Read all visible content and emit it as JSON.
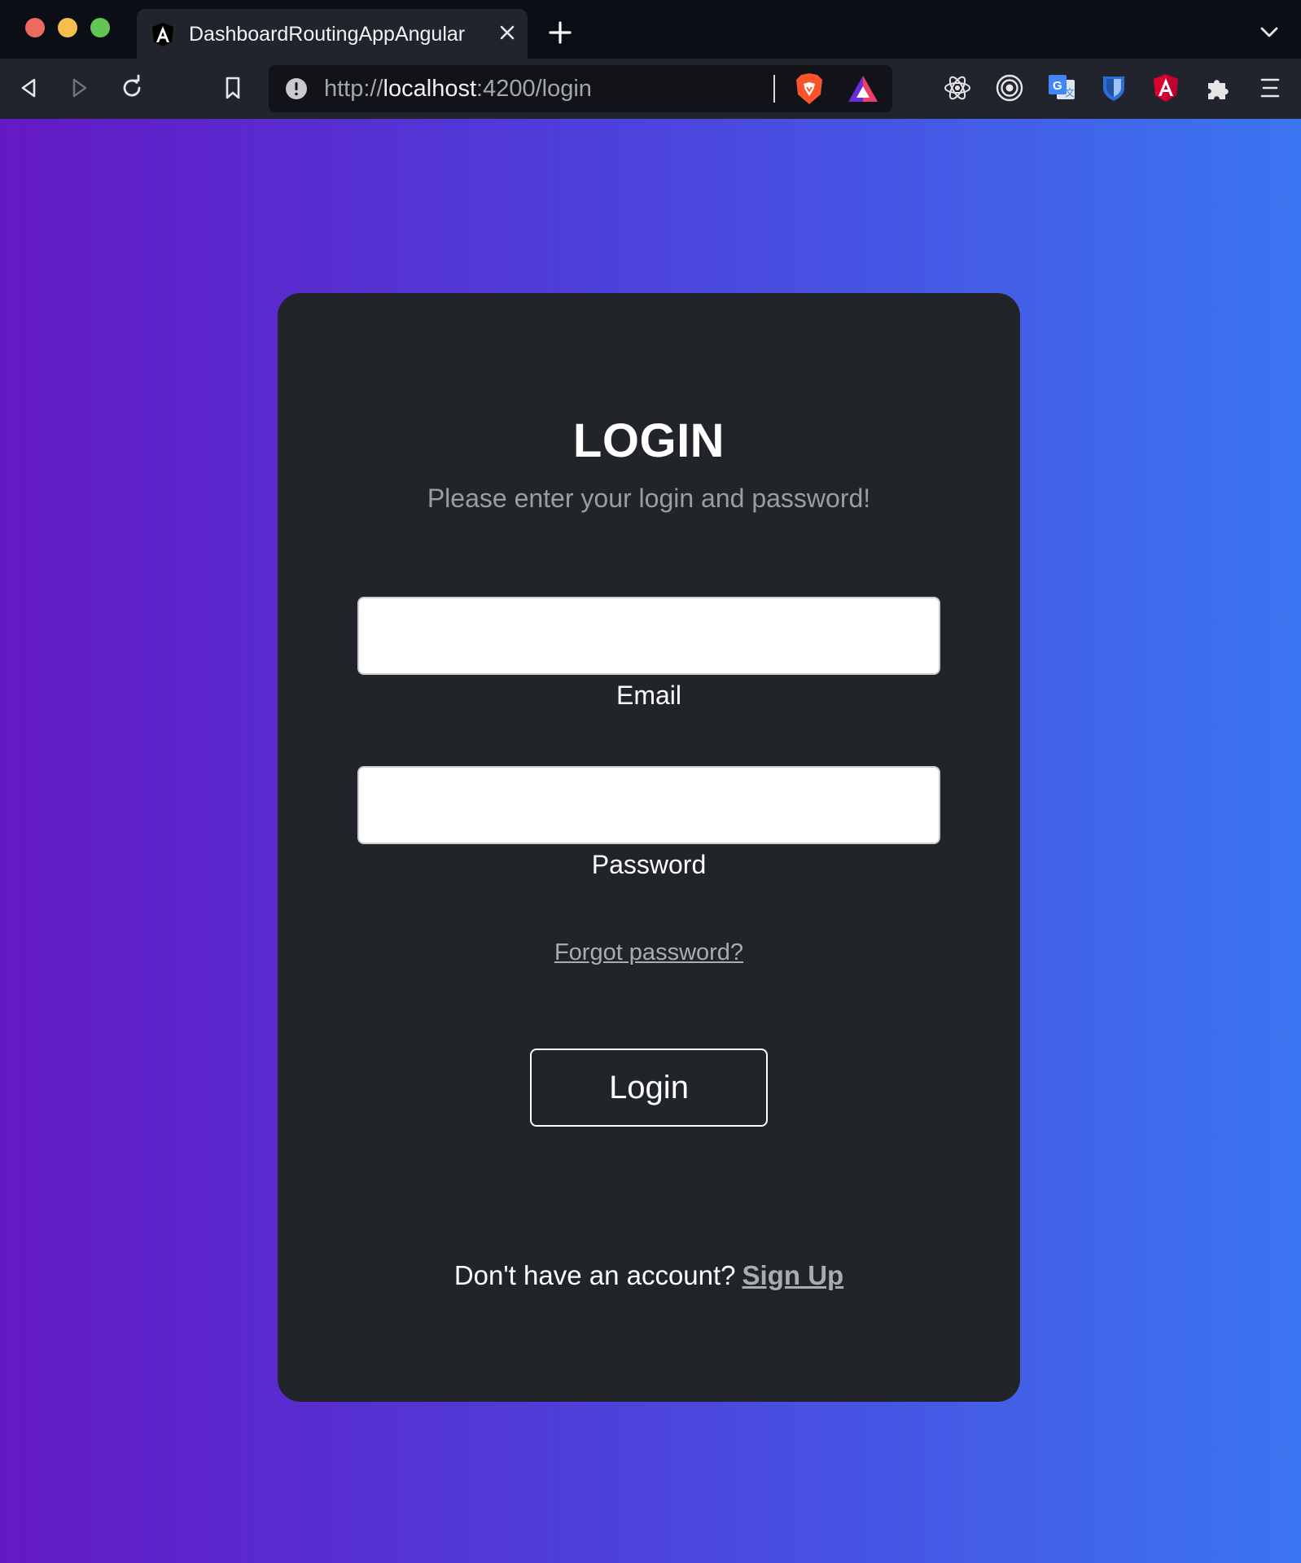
{
  "browser": {
    "tab": {
      "title": "DashboardRoutingAppAngular",
      "icon": "angular-icon"
    },
    "url": {
      "scheme": "http://",
      "host": "localhost",
      "rest": ":4200/login"
    },
    "toolbar_icons": [
      "back-icon",
      "forward-icon",
      "reload-icon",
      "bookmark-icon",
      "info-icon",
      "brave-shields-icon",
      "brave-rewards-icon"
    ],
    "extension_icons": [
      "react-devtools-icon",
      "target-extension-icon",
      "google-translate-icon",
      "bitwarden-shield-icon",
      "angular-devtools-icon",
      "puzzle-icon",
      "menu-icon"
    ],
    "colors": {
      "tabbar": "#0c0e16",
      "toolbar": "#21242d"
    }
  },
  "login": {
    "title": "LOGIN",
    "subtitle": "Please enter your login and password!",
    "email": {
      "label": "Email",
      "value": "",
      "placeholder": ""
    },
    "password": {
      "label": "Password",
      "value": "",
      "placeholder": ""
    },
    "forgot_password": "Forgot password?",
    "login_button": "Login",
    "signup_prompt": "Don't have an account?",
    "signup_link": "Sign Up"
  },
  "colors": {
    "gradient_start": "#6419c4",
    "gradient_end": "#3b75f0",
    "card": "#212428",
    "muted_text": "#9a9da2"
  }
}
